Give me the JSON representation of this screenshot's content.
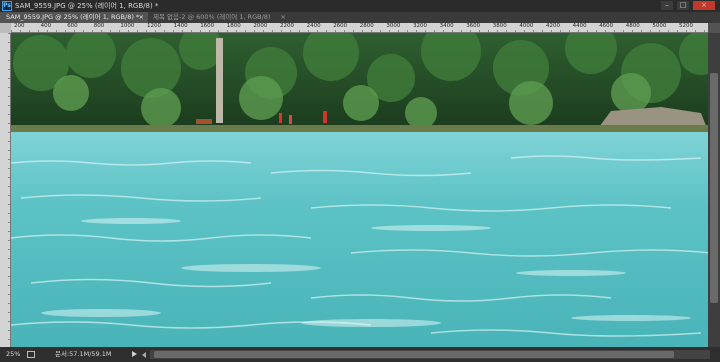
{
  "window": {
    "title": "SAM_9559.JPG @ 25% (레이어 1, RGB/8) *",
    "app_icon": "photoshop-logo",
    "buttons": [
      "minimize-icon",
      "maximize-icon",
      "close-icon"
    ]
  },
  "tabs": [
    {
      "label": "SAM_9559.JPG @ 25% (레이어 1, RGB/8) *",
      "active": true
    },
    {
      "label": "제목 없음-2 @ 600% (레이어 1, RGB/8)",
      "active": false
    }
  ],
  "ruler": {
    "labels": [
      "200",
      "400",
      "600",
      "800",
      "1000",
      "1200",
      "1400",
      "1600",
      "1800",
      "2000",
      "2200",
      "2400",
      "2600",
      "2800",
      "3000",
      "3200",
      "3400",
      "3600",
      "3800",
      "4000",
      "4200",
      "4400",
      "4600",
      "4800",
      "5000",
      "5200"
    ]
  },
  "status": {
    "zoom": "25%",
    "doc_info": "문서:57.1M/59.1M"
  },
  "colors": {
    "water": "#5fc4c6",
    "forest": "#1f4a22",
    "ui_dark": "#2b2b2b"
  }
}
